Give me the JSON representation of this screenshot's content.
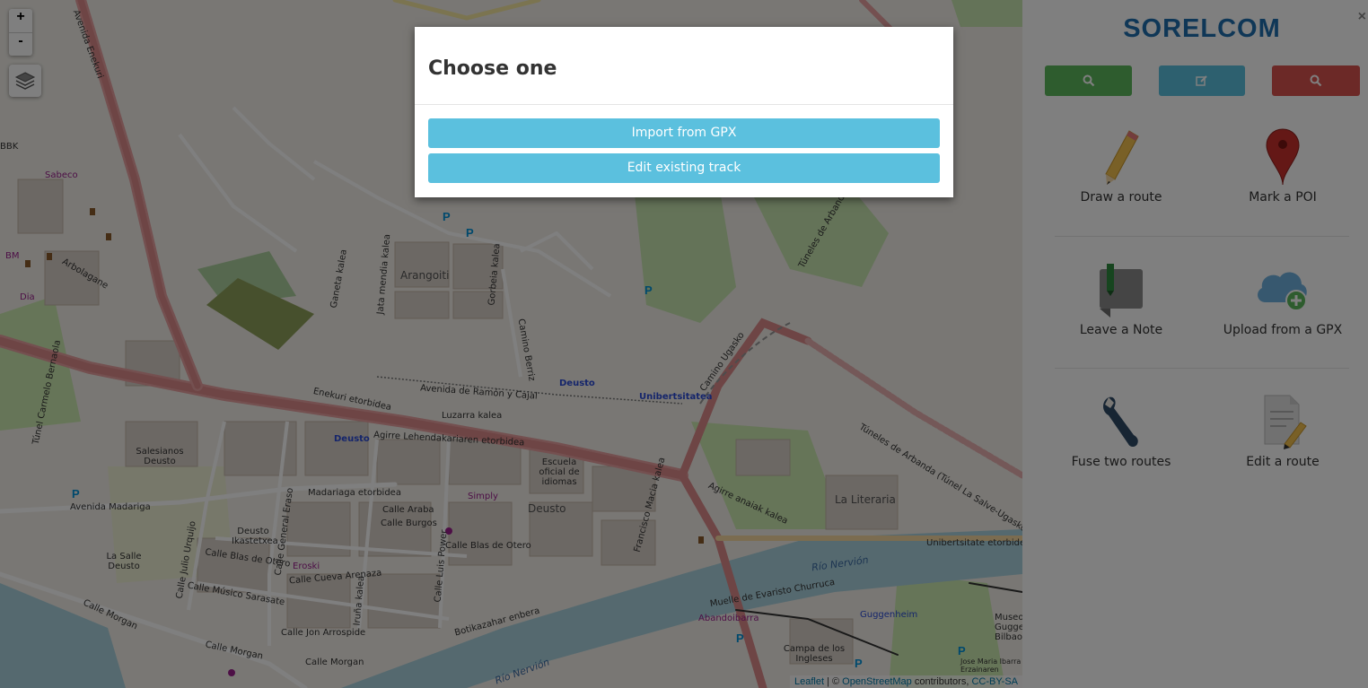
{
  "map": {
    "zoom_in_label": "+",
    "zoom_out_label": "-",
    "layers_icon": "layers-icon",
    "labels": {
      "arangoiti": "Arangoiti",
      "deusto_district": "Deusto",
      "deusto_blue": "Deusto",
      "deusto_blue2": "Deusto",
      "unibertsitatea": "Unibertsitatea",
      "enekuri": "Enekuri etorbidea",
      "agirre": "Agirre Lehendakariaren etorbidea",
      "avenida_ramon": "Avenida de Ramón y Cajal",
      "luzarra": "Luzarra kalea",
      "madariaga": "Madariaga etorbidea",
      "calle_araba": "Calle Araba",
      "calle_burgos": "Calle Burgos",
      "calle_blas": "Calle Blas de Otero",
      "calle_blas2": "Calle Blas de Otero",
      "calle_musico": "Calle Músico Sarasate",
      "calle_cueva": "Calle Cueva Arenaza",
      "calle_jon": "Calle Jon Arrospide",
      "calle_morgan": "Calle Morgan",
      "calle_morgan2": "Calle Morgan",
      "calle_morgan3": "Calle Morgan",
      "avenida_madariga": "Avenida Madariga",
      "rio_nervion": "Río Nervión",
      "rio_nervion2": "Río Nervión",
      "campa": "Campa de los Ingleses",
      "la_literaria": "La Literaria",
      "la_salle": "La Salle Deusto",
      "salesianos": "Salesianos Deusto",
      "deusto_ikastetxea": "Deusto Ikastetxea",
      "escuela": "Escuela oficial de idiomas",
      "guggenheim": "Guggenheim",
      "abandoibarra": "Abandoibarra",
      "unibertsitate_etorbidea": "Unibertsitate etorbidea",
      "tuneles": "Túneles de Arbanda (Túnel La Salve-Ugasko)",
      "tuneles2": "Túneles de Arbanda",
      "camino_ugasko": "Camino Ugasko",
      "arbolagane": "Arbolagane",
      "sabeco": "Sabeco",
      "botikazahar": "Botikazahar enbera",
      "museo": "Museo Guggenheim Bilbao",
      "jose_maria": "Jose Maria Ibarra Erzainaren",
      "simply": "Simply",
      "eroski": "Eroski",
      "dia": "Dia",
      "bbk": "BBK",
      "bm": "BM",
      "tunel_carmelo": "Túnel Carmelo Bernaola",
      "avenida_enekuri": "Avenida Enekuri",
      "francisco": "Francisco Macia kalea",
      "aguirre_anaiak": "Agirre anaiak kalea",
      "muelle": "Muelle de Evaristo Churruca",
      "gorbeia": "Gorbeia kalea",
      "ganeta": "Ganeta kalea",
      "jata": "Jata mendia kalea",
      "camino_berriz": "Camino Berriz",
      "calle_julio": "Calle Julio Urquijo",
      "calle_general": "Calle General Eraso",
      "calle_luis": "Calle Luis Power",
      "iruña": "Iruña kalea"
    },
    "attribution": {
      "leaflet": "Leaflet",
      "sep": " | © ",
      "osm": "OpenStreetMap",
      "contributors": " contributors, ",
      "license": "CC-BY-SA"
    }
  },
  "sidebar": {
    "brand": "SORELCOM",
    "close": "×",
    "buttons": [
      {
        "icon": "search-icon",
        "color": "#5cb85c"
      },
      {
        "icon": "edit-icon",
        "color": "#5bc0de"
      },
      {
        "icon": "search-icon",
        "color": "#d9534f"
      }
    ],
    "tools": {
      "draw_route": "Draw a route",
      "mark_poi": "Mark a POI",
      "leave_note": "Leave a Note",
      "upload_gpx": "Upload from a GPX",
      "fuse_routes": "Fuse two routes",
      "edit_route": "Edit a route"
    }
  },
  "modal": {
    "title": "Choose one",
    "buttons": {
      "import": "Import from GPX",
      "edit": "Edit existing track"
    }
  },
  "colors": {
    "brand": "#1f6fae",
    "info": "#5bc0de",
    "success": "#5cb85c",
    "danger": "#d9534f"
  }
}
